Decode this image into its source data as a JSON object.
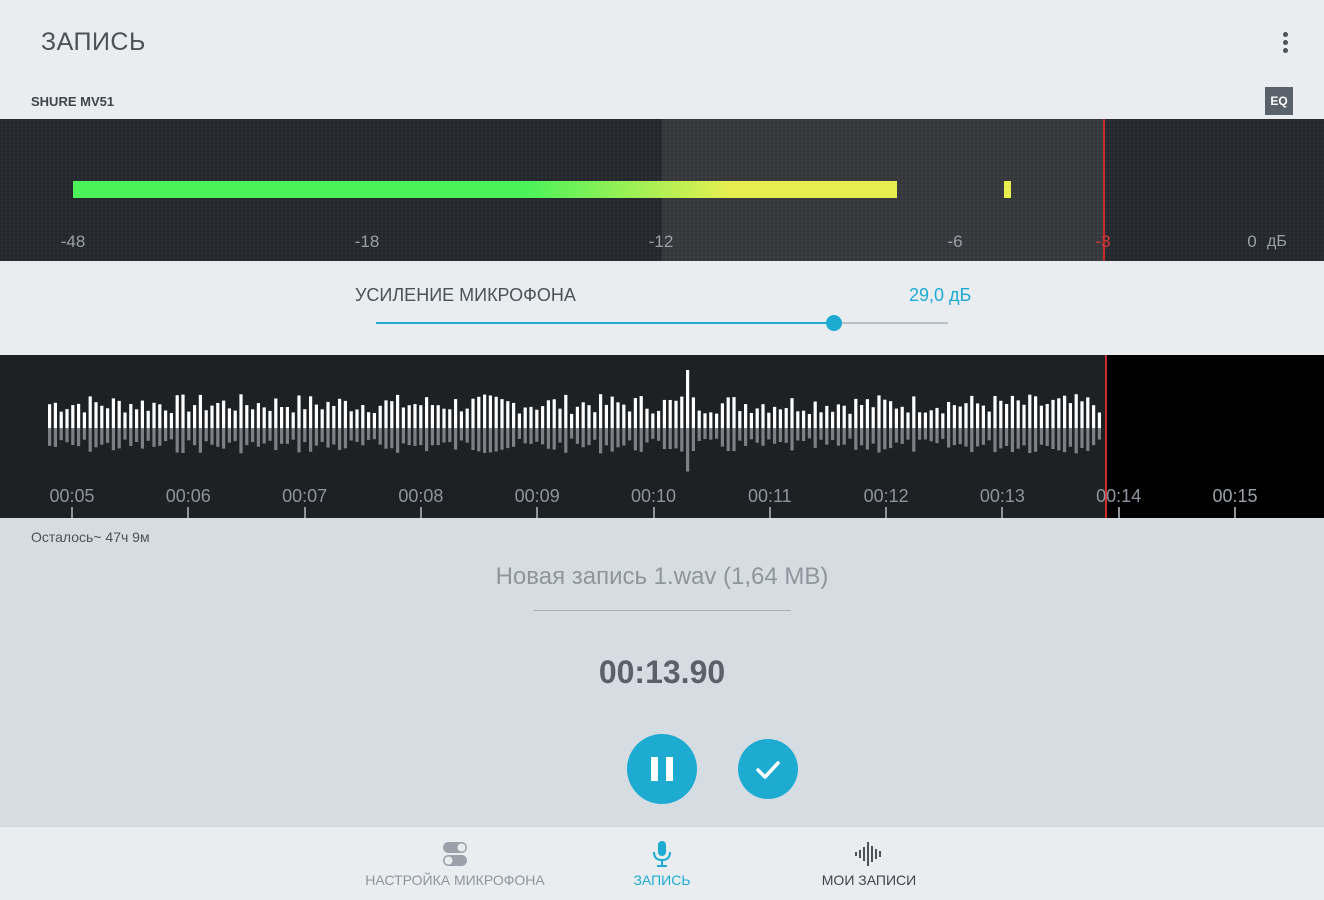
{
  "appbar": {
    "title": "ЗАПИСЬ",
    "menu_icon": "more-vert-icon"
  },
  "device": {
    "name": "SHURE MV51",
    "eq_label": "EQ"
  },
  "meter": {
    "scale": [
      "-48",
      "-18",
      "-12",
      "-6",
      "-3",
      "0"
    ],
    "unit": "дБ",
    "clip_mark": "-3",
    "colors": {
      "green": "#4cf25a",
      "yellow": "#e8ee50",
      "red": "#c62b2b"
    }
  },
  "gain": {
    "label": "УСИЛЕНИЕ МИКРОФОНА",
    "value": "29,0 дБ",
    "level_fraction": 0.8
  },
  "waveform": {
    "timeline": [
      "00:05",
      "00:06",
      "00:07",
      "00:08",
      "00:09",
      "00:10",
      "00:11",
      "00:12",
      "00:13",
      "00:14",
      "00:15"
    ]
  },
  "recording": {
    "remaining": "Осталось~ 47ч 9м",
    "filename": "Новая запись 1.wav (1,64 MB)",
    "elapsed": "00:13.90"
  },
  "controls": {
    "pause_icon": "pause-icon",
    "done_icon": "check-icon"
  },
  "nav": {
    "items": [
      {
        "label": "НАСТРОЙКА МИКРОФОНА",
        "icon": "toggles-icon",
        "active": false
      },
      {
        "label": "ЗАПИСЬ",
        "icon": "microphone-icon",
        "active": true
      },
      {
        "label": "МОИ ЗАПИСИ",
        "icon": "waveform-icon",
        "active": false
      }
    ]
  },
  "accent_color": "#1eabd2"
}
